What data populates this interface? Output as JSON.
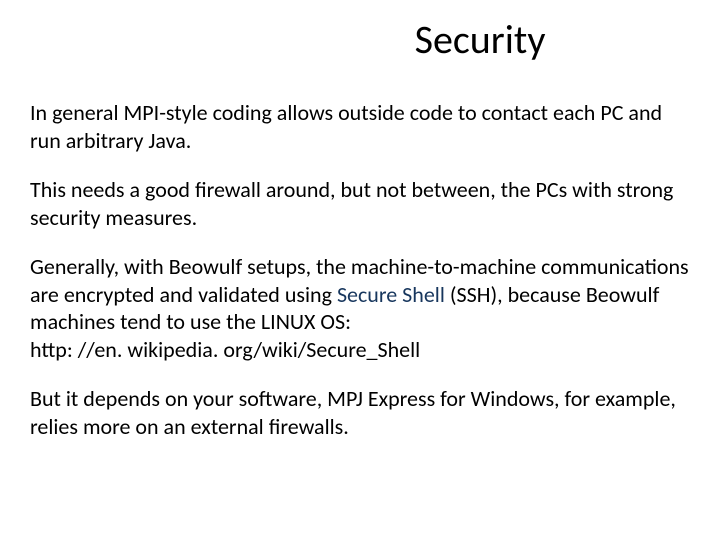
{
  "slide": {
    "title": "Security",
    "paragraphs": {
      "p1": "In general MPI-style coding allows outside code to contact each PC and run arbitrary Java.",
      "p2": "This needs a good firewall around, but not between, the PCs with strong security measures.",
      "p3_pre": "Generally, with Beowulf setups, the machine-to-machine communications are encrypted and validated using ",
      "p3_link": "Secure Shell",
      "p3_post": " (SSH), because Beowulf machines tend to use the LINUX OS:",
      "p3_url": " http: //en. wikipedia. org/wiki/Secure_Shell",
      "p4": "But it depends on your software, MPJ Express for Windows, for example, relies more on an external firewalls."
    }
  }
}
